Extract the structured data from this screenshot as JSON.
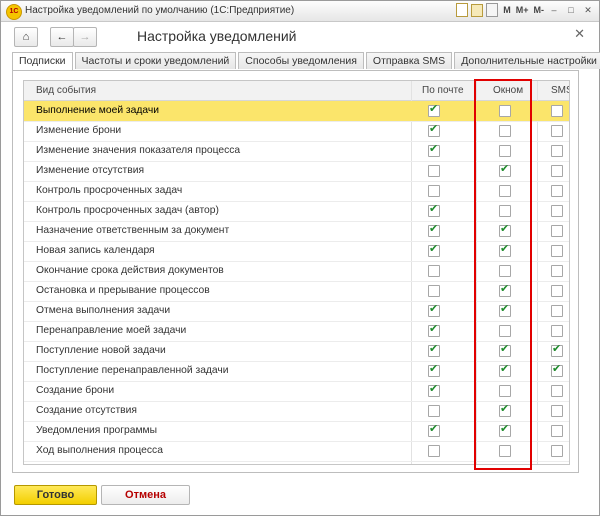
{
  "window": {
    "title": "Настройка уведомлений по умолчанию (1С:Предприятие)",
    "mem_labels": [
      "M",
      "M+",
      "M-"
    ]
  },
  "page": {
    "title": "Настройка уведомлений"
  },
  "tabs": [
    {
      "label": "Подписки",
      "active": true
    },
    {
      "label": "Частоты и сроки уведомлений",
      "active": false
    },
    {
      "label": "Способы уведомления",
      "active": false
    },
    {
      "label": "Отправка SMS",
      "active": false
    },
    {
      "label": "Дополнительные настройки",
      "active": false
    }
  ],
  "table": {
    "headers": {
      "event": "Вид события",
      "mail": "По почте",
      "window": "Окном",
      "sms": "SMS"
    },
    "rows": [
      {
        "name": "Выполнение моей задачи",
        "mail": true,
        "window": false,
        "sms": false,
        "selected": true
      },
      {
        "name": "Изменение брони",
        "mail": true,
        "window": false,
        "sms": false
      },
      {
        "name": "Изменение значения показателя процесса",
        "mail": true,
        "window": false,
        "sms": false
      },
      {
        "name": "Изменение отсутствия",
        "mail": false,
        "window": true,
        "sms": false
      },
      {
        "name": "Контроль просроченных задач",
        "mail": false,
        "window": false,
        "sms": false
      },
      {
        "name": "Контроль просроченных задач (автор)",
        "mail": true,
        "window": false,
        "sms": false
      },
      {
        "name": "Назначение ответственным за документ",
        "mail": true,
        "window": true,
        "sms": false
      },
      {
        "name": "Новая запись календаря",
        "mail": true,
        "window": true,
        "sms": false
      },
      {
        "name": "Окончание срока действия документов",
        "mail": false,
        "window": false,
        "sms": false
      },
      {
        "name": "Остановка и прерывание процессов",
        "mail": false,
        "window": true,
        "sms": false
      },
      {
        "name": "Отмена выполнения задачи",
        "mail": true,
        "window": true,
        "sms": false
      },
      {
        "name": "Перенаправление моей задачи",
        "mail": true,
        "window": false,
        "sms": false
      },
      {
        "name": "Поступление новой задачи",
        "mail": true,
        "window": true,
        "sms": true
      },
      {
        "name": "Поступление перенаправленной задачи",
        "mail": true,
        "window": true,
        "sms": true
      },
      {
        "name": "Создание брони",
        "mail": true,
        "window": false,
        "sms": false
      },
      {
        "name": "Создание отсутствия",
        "mail": false,
        "window": true,
        "sms": false
      },
      {
        "name": "Уведомления программы",
        "mail": true,
        "window": true,
        "sms": false
      },
      {
        "name": "Ход выполнения процесса",
        "mail": false,
        "window": false,
        "sms": false
      }
    ]
  },
  "buttons": {
    "ok": "Готово",
    "cancel": "Отмена"
  },
  "colors": {
    "selection": "#fbe56b",
    "check": "#1d8a2a",
    "highlight_box": "#e10000",
    "ok_button": "#f3cf00"
  }
}
